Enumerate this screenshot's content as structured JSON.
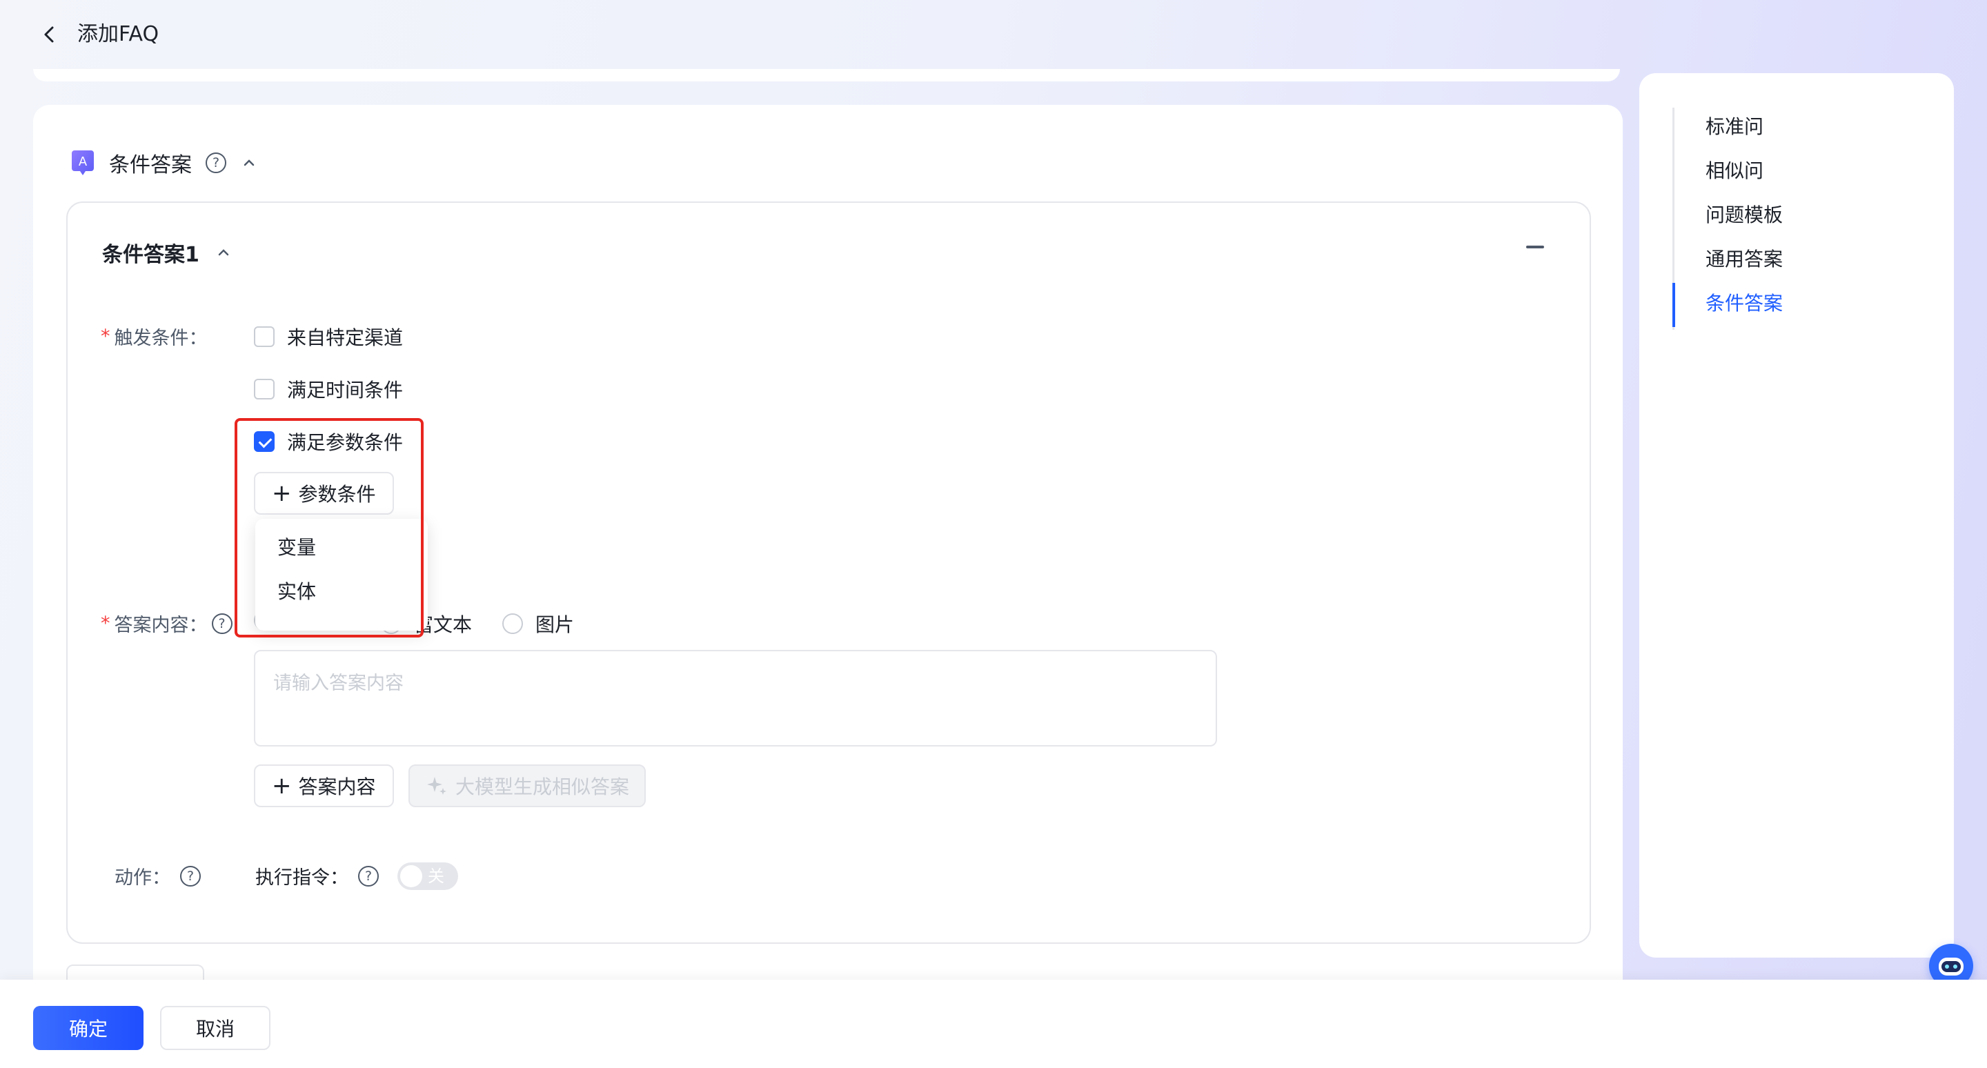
{
  "header": {
    "title": "添加FAQ"
  },
  "section": {
    "title": "条件答案"
  },
  "condition_answer": {
    "title": "条件答案1",
    "trigger_label": "触发条件：",
    "triggers": [
      {
        "label": "来自特定渠道",
        "checked": false
      },
      {
        "label": "满足时间条件",
        "checked": false
      },
      {
        "label": "满足参数条件",
        "checked": true
      }
    ],
    "param_button": "参数条件",
    "dropdown_items": [
      "变量",
      "实体"
    ],
    "answer_label": "答案内容：",
    "answer_types": [
      "富文本",
      "图片"
    ],
    "answer_placeholder": "请输入答案内容",
    "add_answer_button": "答案内容",
    "ai_button": "大模型生成相似答案",
    "action_label": "动作：",
    "execute_label": "执行指令：",
    "execute_toggle": "关"
  },
  "anchor_nav": {
    "items": [
      "标准问",
      "相似问",
      "问题模板",
      "通用答案",
      "条件答案"
    ],
    "active": "条件答案"
  },
  "footer": {
    "confirm": "确定",
    "cancel": "取消"
  },
  "colors": {
    "primary": "#1f5eff",
    "highlight": "#e8251f",
    "required": "#f53f3f"
  }
}
